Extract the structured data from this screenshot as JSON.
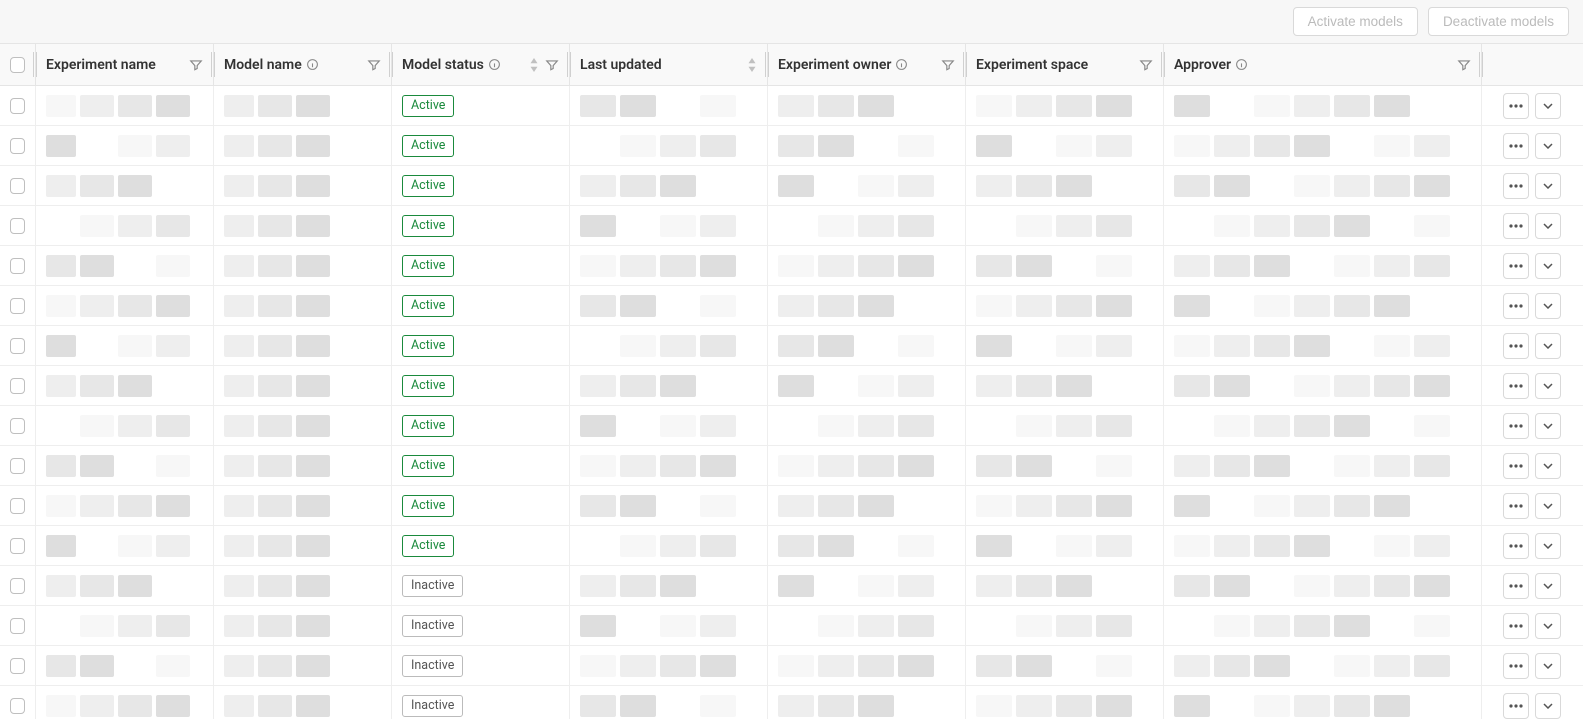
{
  "toolbar": {
    "activate_label": "Activate models",
    "deactivate_label": "Deactivate models"
  },
  "columns": {
    "experiment_name": "Experiment name",
    "model_name": "Model name",
    "model_status": "Model status",
    "last_updated": "Last updated",
    "experiment_owner": "Experiment owner",
    "experiment_space": "Experiment space",
    "approver": "Approver"
  },
  "status": {
    "active": "Active",
    "inactive": "Inactive"
  },
  "rows": [
    {
      "status": "active"
    },
    {
      "status": "active"
    },
    {
      "status": "active"
    },
    {
      "status": "active"
    },
    {
      "status": "active"
    },
    {
      "status": "active"
    },
    {
      "status": "active"
    },
    {
      "status": "active"
    },
    {
      "status": "active"
    },
    {
      "status": "active"
    },
    {
      "status": "active"
    },
    {
      "status": "active"
    },
    {
      "status": "inactive"
    },
    {
      "status": "inactive"
    },
    {
      "status": "inactive"
    },
    {
      "status": "inactive"
    }
  ]
}
